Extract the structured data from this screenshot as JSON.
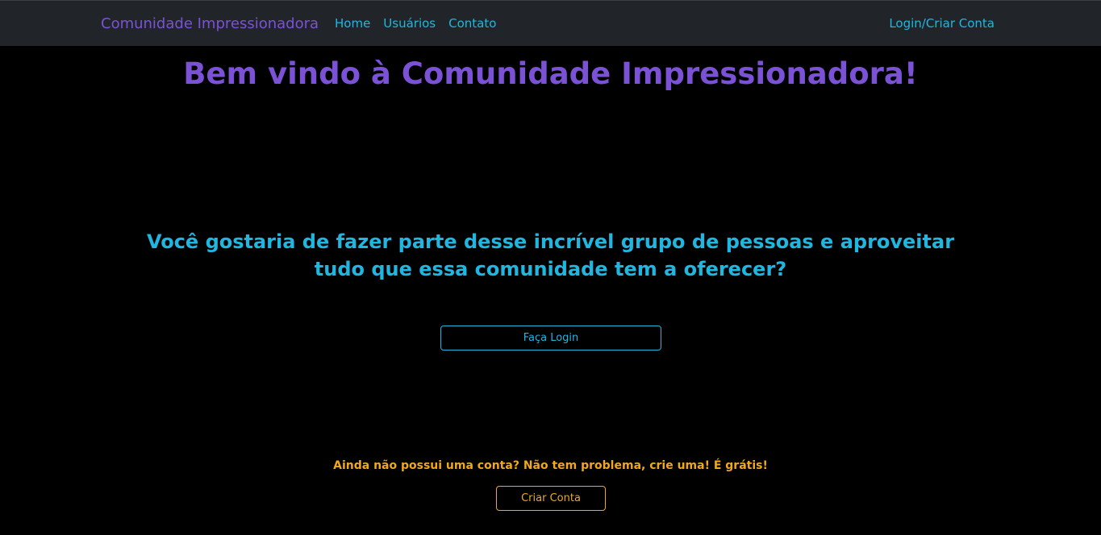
{
  "navbar": {
    "brand": "Comunidade Impressionadora",
    "links": [
      {
        "label": "Home"
      },
      {
        "label": "Usuários"
      },
      {
        "label": "Contato"
      }
    ],
    "right_link": "Login/Criar Conta"
  },
  "main": {
    "title": "Bem vindo à Comunidade Impressionadora!",
    "question": "Você gostaria de fazer parte desse incrível grupo de pessoas e aproveitar tudo que essa comunidade tem a oferecer?",
    "login_button": "Faça Login",
    "signup_prompt": "Ainda não possui uma conta? Não tem problema, crie uma! É grátis!",
    "signup_button": "Criar Conta"
  },
  "colors": {
    "navbar_bg": "#212529",
    "brand_purple": "#7b52d6",
    "link_cyan": "#1fb6e0",
    "accent_orange": "#f0a81e",
    "page_bg": "#000000"
  }
}
